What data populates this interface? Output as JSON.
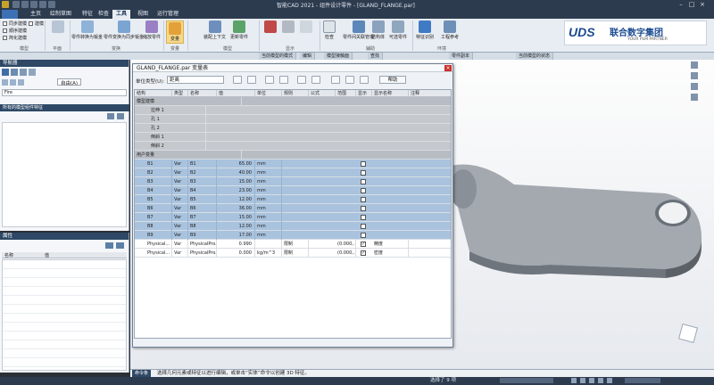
{
  "app": {
    "title": "智能CAD 2021 - 组件设计零件 - [GLAND_FLANGE.par]"
  },
  "tabs": [
    "主页",
    "绘制草图",
    "特征",
    "检查",
    "工具",
    "视图",
    "运行管理"
  ],
  "active_tab_index": 4,
  "ribbon": {
    "checks": [
      "同步建模",
      "顺序建模",
      "简化建模"
    ],
    "check_extra": "建模",
    "groups": [
      {
        "label": "模型",
        "buttons": []
      },
      {
        "label": "平面",
        "buttons": []
      },
      {
        "label": "变换",
        "buttons": [
          "零件转换为钣金",
          "零件变换为同步钣金",
          "缩放零件"
        ]
      },
      {
        "label": "变量",
        "buttons": [
          "变量"
        ]
      },
      {
        "label": "模型",
        "buttons": [
          "装配上下文",
          "更新零件"
        ]
      },
      {
        "label": "显示",
        "buttons": [
          "高亮显示",
          "显示"
        ]
      },
      {
        "label": "辅助",
        "buttons": [
          "检查",
          "零件间关联管理",
          "结构体",
          "可选零件"
        ]
      },
      {
        "label": "环境",
        "buttons": [
          "特征识别",
          "工程参考"
        ]
      }
    ]
  },
  "logo": {
    "mark": "UDS",
    "name": "联合数字集团",
    "tagline": "YOUR PLM PARTNER",
    "brand_color": "#1b4b91"
  },
  "toolrow": {
    "pills": [
      "当前模型的模式",
      "编辑",
      "模型接触面",
      "查找",
      "零件副本",
      "当前模型的状态"
    ]
  },
  "left_panel": {
    "title": "导航器",
    "dropdown_value": "自由(A)",
    "filter_placeholder": "Fire",
    "section_title": "所有的模型组件特征",
    "props_title": "属性",
    "props_cols": [
      "名称",
      "值"
    ]
  },
  "dialog": {
    "title": "GLAND_FLANGE.par 变量表",
    "unit_label": "单位类型(U):",
    "unit_value": "距离",
    "help_label": "帮助",
    "columns": [
      "结构",
      "类型",
      "名称",
      "值",
      "单位",
      "规则",
      "公式",
      "范围",
      "显示",
      "显示名称",
      "注释"
    ],
    "tree_header": "模型建模",
    "tree_items": [
      "拉伸 1",
      "孔 1",
      "孔 2",
      "倒斜 1",
      "倒斜 2"
    ],
    "user_header": "用户变量",
    "rows": [
      {
        "name": "B1",
        "type": "Var",
        "label": "B1",
        "value": "65.00",
        "unit": "mm"
      },
      {
        "name": "B2",
        "type": "Var",
        "label": "B2",
        "value": "40.00",
        "unit": "mm"
      },
      {
        "name": "B3",
        "type": "Var",
        "label": "B3",
        "value": "15.00",
        "unit": "mm"
      },
      {
        "name": "B4",
        "type": "Var",
        "label": "B4",
        "value": "23.00",
        "unit": "mm"
      },
      {
        "name": "B5",
        "type": "Var",
        "label": "B5",
        "value": "12.00",
        "unit": "mm"
      },
      {
        "name": "B6",
        "type": "Var",
        "label": "B6",
        "value": "36.00",
        "unit": "mm"
      },
      {
        "name": "B7",
        "type": "Var",
        "label": "B7",
        "value": "15.00",
        "unit": "mm"
      },
      {
        "name": "B8",
        "type": "Var",
        "label": "B8",
        "value": "12.00",
        "unit": "mm"
      },
      {
        "name": "B9",
        "type": "Var",
        "label": "B9",
        "value": "17.00",
        "unit": "mm"
      }
    ],
    "phys_rows": [
      {
        "name": "Physical...",
        "type": "Var",
        "label": "PhysicalPro...",
        "value": "0.990",
        "unit": "",
        "rule": "限制",
        "range": "(0.000,...",
        "checked": true,
        "display": "精度"
      },
      {
        "name": "Physical...",
        "type": "Var",
        "label": "PhysicalPro...",
        "value": "0.000",
        "unit": "kg/m^3",
        "rule": "限制",
        "range": "(0.000,...",
        "checked": true,
        "display": "密度"
      }
    ]
  },
  "command_bar": {
    "label": "命令条",
    "prompt": "选择几何元素或特征以进行编辑，或单击“实体”命令以创建 3D 特征。"
  },
  "status": {
    "selected": "选择了 9 项"
  }
}
